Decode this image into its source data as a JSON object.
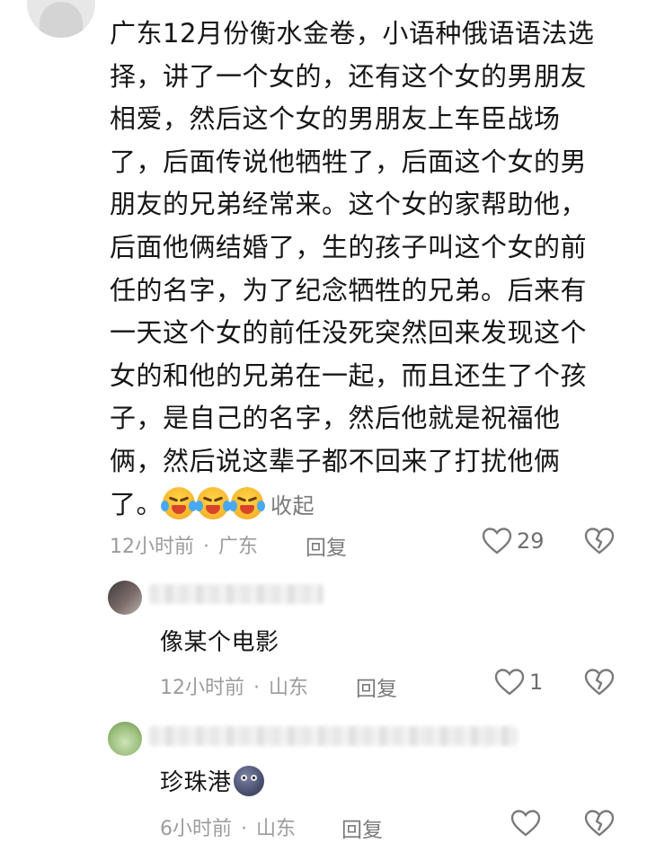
{
  "main_comment": {
    "text": "广东12月份衡水金卷，小语种俄语语法选择，讲了一个女的，还有这个女的男朋友相爱，然后这个女的男朋友上车臣战场了，后面传说他牺牲了，后面这个女的男朋友的兄弟经常来。这个女的家帮助他，后面他俩结婚了，生的孩子叫这个女的前任的名字，为了纪念牺牲的兄弟。后来有一天这个女的前任没死突然回来发现这个女的和他的兄弟在一起，而且还生了个孩子，是自己的名字，然后他就是祝福他俩，然后说这辈子都不回来了打扰他俩了。",
    "emoji_icons": [
      "laughing-crying-emoji",
      "laughing-crying-emoji",
      "laughing-crying-emoji"
    ],
    "collapse_label": "收起",
    "time": "12小时前",
    "location": "广东",
    "reply_label": "回复",
    "like_count": "29"
  },
  "replies": [
    {
      "text": "像某个电影",
      "time": "12小时前",
      "location": "山东",
      "reply_label": "回复",
      "like_count": "1",
      "emoji_icon": ""
    },
    {
      "text": "珍珠港",
      "time": "6小时前",
      "location": "山东",
      "reply_label": "回复",
      "like_count": "",
      "emoji_icon": "new-moon-face-emoji"
    }
  ],
  "separator": "·",
  "colors": {
    "meta_gray": "#9c9c9c",
    "text": "#161616",
    "icon_gray": "#7a7a7a"
  }
}
